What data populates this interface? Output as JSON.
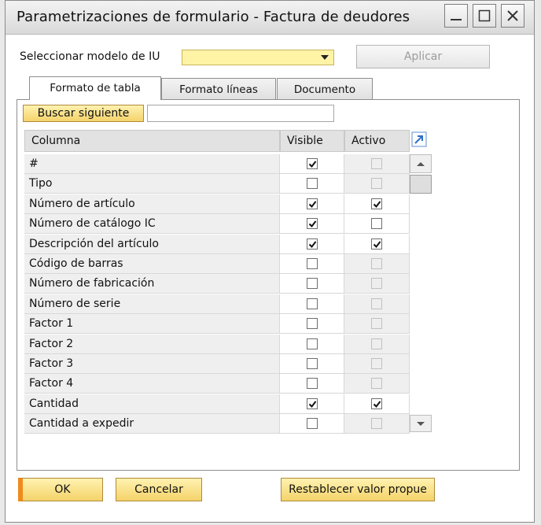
{
  "window": {
    "title": "Parametrizaciones de formulario - Factura de deudores"
  },
  "top": {
    "ui_model_label": "Seleccionar modelo de IU",
    "ui_model_value": "",
    "apply_label": "Aplicar"
  },
  "tabs": [
    {
      "label": "Formato de tabla",
      "active": true
    },
    {
      "label": "Formato líneas",
      "active": false
    },
    {
      "label": "Documento",
      "active": false
    }
  ],
  "search": {
    "button_label": "Buscar siguiente",
    "value": ""
  },
  "table": {
    "headers": {
      "column": "Columna",
      "visible": "Visible",
      "active": "Activo"
    },
    "rows": [
      {
        "name": "#",
        "visible": true,
        "active": false,
        "active_enabled": false
      },
      {
        "name": "Tipo",
        "visible": false,
        "active": false,
        "active_enabled": false
      },
      {
        "name": "Número de artículo",
        "visible": true,
        "active": true,
        "active_enabled": true
      },
      {
        "name": "Número de catálogo IC",
        "visible": true,
        "active": false,
        "active_enabled": true
      },
      {
        "name": "Descripción del artículo",
        "visible": true,
        "active": true,
        "active_enabled": true
      },
      {
        "name": "Código de barras",
        "visible": false,
        "active": false,
        "active_enabled": false
      },
      {
        "name": "Número de fabricación",
        "visible": false,
        "active": false,
        "active_enabled": false
      },
      {
        "name": "Número de serie",
        "visible": false,
        "active": false,
        "active_enabled": false
      },
      {
        "name": "Factor 1",
        "visible": false,
        "active": false,
        "active_enabled": false
      },
      {
        "name": "Factor 2",
        "visible": false,
        "active": false,
        "active_enabled": false
      },
      {
        "name": "Factor 3",
        "visible": false,
        "active": false,
        "active_enabled": false
      },
      {
        "name": "Factor 4",
        "visible": false,
        "active": false,
        "active_enabled": false
      },
      {
        "name": "Cantidad",
        "visible": true,
        "active": true,
        "active_enabled": true
      },
      {
        "name": "Cantidad a expedir",
        "visible": false,
        "active": false,
        "active_enabled": false
      }
    ]
  },
  "footer": {
    "ok_label": "OK",
    "cancel_label": "Cancelar",
    "reset_label": "Restablecer valor propue"
  },
  "colors": {
    "accent_yellow": "#fff3a6",
    "button_yellow": "#f4d36a",
    "ok_orange": "#f08a1c"
  }
}
